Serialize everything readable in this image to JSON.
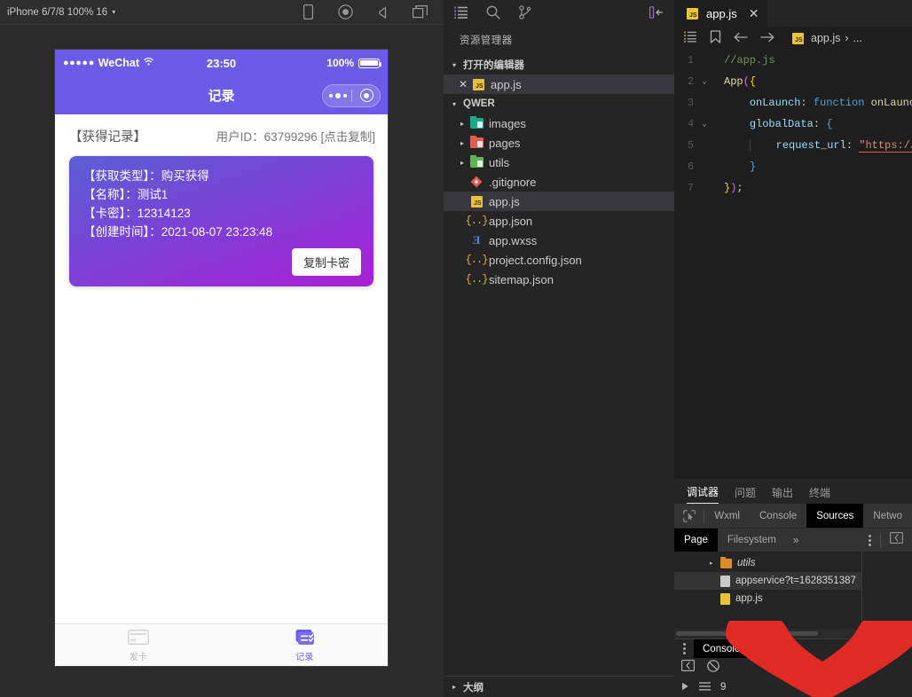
{
  "simulator": {
    "device_selector": "iPhone 6/7/8 100% 16",
    "caret": "▾",
    "toolbar_icons": [
      "device-icon",
      "record-icon",
      "volume-icon",
      "window-icon"
    ],
    "status_bar": {
      "signal_dots": "●●●●●",
      "carrier": "WeChat",
      "wifi": "⇡",
      "time": "23:50",
      "battery_pct": "100%"
    },
    "nav": {
      "title": "记录"
    },
    "page": {
      "heading_left": "【获得记录】",
      "heading_right": "用户ID：63799296 [点击复制]",
      "card": {
        "lines": [
          "【获取类型】：购买获得",
          "【名称】：测试1",
          "【卡密】：12314123",
          "【创建时间】：2021-08-07 23:23:48"
        ],
        "button": "复制卡密"
      }
    },
    "tabbar": [
      {
        "label": "发卡",
        "icon": "card-icon",
        "active": false
      },
      {
        "label": "记录",
        "icon": "list-icon",
        "active": true
      }
    ]
  },
  "explorer": {
    "toolbar_icons": [
      "explorer-icon",
      "search-icon",
      "source-control-icon",
      "collapse-panel-icon"
    ],
    "title": "资源管理器",
    "open_editors": {
      "label": "打开的编辑器",
      "twisty": "▾",
      "items": [
        {
          "name": "app.js",
          "icon": "js-icon",
          "close": "✕"
        }
      ]
    },
    "project": {
      "label": "QWER",
      "twisty": "▾",
      "items": [
        {
          "name": "images",
          "type": "folder",
          "twisty": "▸",
          "color": "#1aa88b",
          "selected": false
        },
        {
          "name": "pages",
          "type": "folder",
          "twisty": "▸",
          "color": "#e05c4e",
          "selected": false
        },
        {
          "name": "utils",
          "type": "folder",
          "twisty": "▸",
          "color": "#5ab552",
          "selected": false
        },
        {
          "name": ".gitignore",
          "type": "git",
          "twisty": "",
          "color": "#e05c4e",
          "selected": false
        },
        {
          "name": "app.js",
          "type": "js",
          "twisty": "",
          "color": "#e8c33a",
          "selected": true
        },
        {
          "name": "app.json",
          "type": "json",
          "twisty": "",
          "color": "#d9b44a",
          "selected": false
        },
        {
          "name": "app.wxss",
          "type": "wxss",
          "twisty": "",
          "color": "#4a8fe0",
          "selected": false
        },
        {
          "name": "project.config.json",
          "type": "json",
          "twisty": "",
          "color": "#d9b44a",
          "selected": false
        },
        {
          "name": "sitemap.json",
          "type": "json",
          "twisty": "",
          "color": "#d9b44a",
          "selected": false
        }
      ]
    },
    "outline": {
      "label": "大纲",
      "twisty": "▸"
    }
  },
  "editor": {
    "tab": {
      "label": "app.js",
      "icon": "js-icon",
      "close": "✕"
    },
    "breadcrumb_icons": [
      "outline-icon",
      "bookmark-icon",
      "back-arrow-icon",
      "forward-arrow-icon"
    ],
    "breadcrumb": {
      "file": "app.js",
      "sep": "›",
      "more": "..."
    },
    "lines": [
      {
        "no": "1",
        "fold": "",
        "segments": [
          {
            "t": "//app.js",
            "c": "k-com"
          }
        ]
      },
      {
        "no": "2",
        "fold": "⌄",
        "segments": [
          {
            "t": "App",
            "c": "k-fn"
          },
          {
            "t": "(",
            "c": "k-brk"
          },
          {
            "t": "{",
            "c": "k-p2"
          }
        ]
      },
      {
        "no": "3",
        "fold": "",
        "segments": [
          {
            "t": "    ",
            "c": "k-pun"
          },
          {
            "t": "onLaunch",
            "c": "k-var"
          },
          {
            "t": ": ",
            "c": "k-pun"
          },
          {
            "t": "function",
            "c": "k-kw"
          },
          {
            "t": " onLaunc",
            "c": "k-fn"
          }
        ]
      },
      {
        "no": "4",
        "fold": "⌄",
        "segments": [
          {
            "t": "    ",
            "c": "k-pun"
          },
          {
            "t": "globalData",
            "c": "k-var"
          },
          {
            "t": ": ",
            "c": "k-pun"
          },
          {
            "t": "{",
            "c": "k-kw"
          }
        ]
      },
      {
        "no": "5",
        "fold": "",
        "segments": [
          {
            "t": "        ",
            "c": "k-pun"
          },
          {
            "t": "request_url",
            "c": "k-var"
          },
          {
            "t": ": ",
            "c": "k-pun"
          },
          {
            "t": "\"",
            "c": "k-str"
          },
          {
            "t": "https://",
            "c": "k-str"
          }
        ]
      },
      {
        "no": "6",
        "fold": "",
        "segments": [
          {
            "t": "    ",
            "c": "k-pun"
          },
          {
            "t": "}",
            "c": "k-kw"
          }
        ]
      },
      {
        "no": "7",
        "fold": "",
        "segments": [
          {
            "t": "}",
            "c": "k-p2"
          },
          {
            "t": ")",
            "c": "k-brk"
          },
          {
            "t": ";",
            "c": "k-pun"
          }
        ]
      }
    ]
  },
  "devtools": {
    "panel_tabs": [
      {
        "label": "调试器",
        "selected": true
      },
      {
        "label": "问题",
        "selected": false
      },
      {
        "label": "输出",
        "selected": false
      },
      {
        "label": "终端",
        "selected": false
      }
    ],
    "inspector_tabs": [
      {
        "label": "Wxml",
        "selected": false
      },
      {
        "label": "Console",
        "selected": false
      },
      {
        "label": "Sources",
        "selected": true
      },
      {
        "label": "Netwo",
        "selected": false
      }
    ],
    "cursor_icon": "inspect-cursor-icon",
    "sources_tabs": [
      {
        "label": "Page",
        "selected": true
      },
      {
        "label": "Filesystem",
        "selected": false
      }
    ],
    "sources_more": "»",
    "sources_tree": [
      {
        "name": "utils",
        "type": "folder",
        "twisty": "▸",
        "italic": true,
        "selected": false
      },
      {
        "name": "appservice?t=1628351387",
        "type": "doc",
        "twisty": "",
        "italic": false,
        "selected": true
      },
      {
        "name": "app.js",
        "type": "doc-yellow",
        "twisty": "",
        "italic": false,
        "selected": false
      }
    ],
    "console": {
      "tab_label": "Console",
      "tools": [
        "clear-console-icon",
        "no-entry-icon"
      ],
      "filter_row": [
        "expand-icon",
        "list-icon",
        "9"
      ]
    }
  },
  "overlay": {
    "shape": "heart",
    "color": "#e02b25"
  }
}
